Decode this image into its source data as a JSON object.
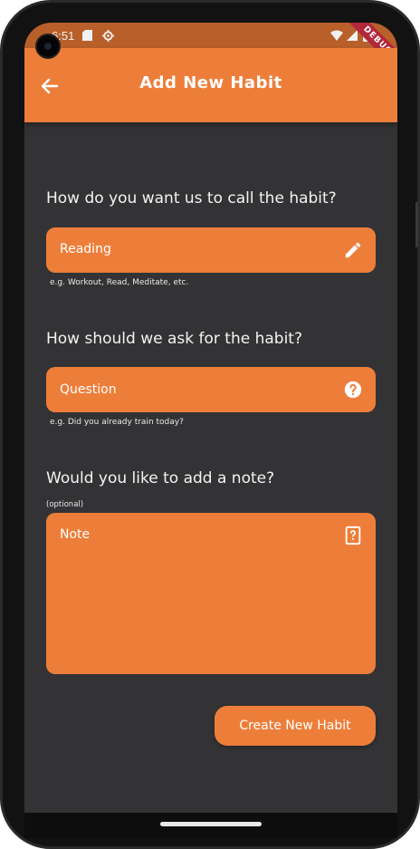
{
  "status_bar": {
    "time": "6:51",
    "icons": [
      "sd-card-icon",
      "gear-icon",
      "wifi-icon",
      "signal-icon",
      "battery-icon"
    ]
  },
  "debug_banner": "DEBUG",
  "app_bar": {
    "title": "Add New Habit",
    "back_icon": "arrow-back-icon"
  },
  "habit_name": {
    "question": "How do you want us to call the habit?",
    "value": "Reading",
    "icon": "pencil-icon",
    "helper": "e.g. Workout, Read, Meditate, etc."
  },
  "habit_question": {
    "question": "How should we ask for the habit?",
    "placeholder": "Question",
    "icon": "help-circle-icon",
    "helper": "e.g. Did you already train today?"
  },
  "habit_note": {
    "question": "Would you like to add a note?",
    "optional": "(optional)",
    "placeholder": "Note",
    "icon": "note-question-icon"
  },
  "create_button": "Create New Habit",
  "colors": {
    "accent": "#ed7e3a",
    "background": "#333335",
    "status_bar": "#b85f2a"
  }
}
